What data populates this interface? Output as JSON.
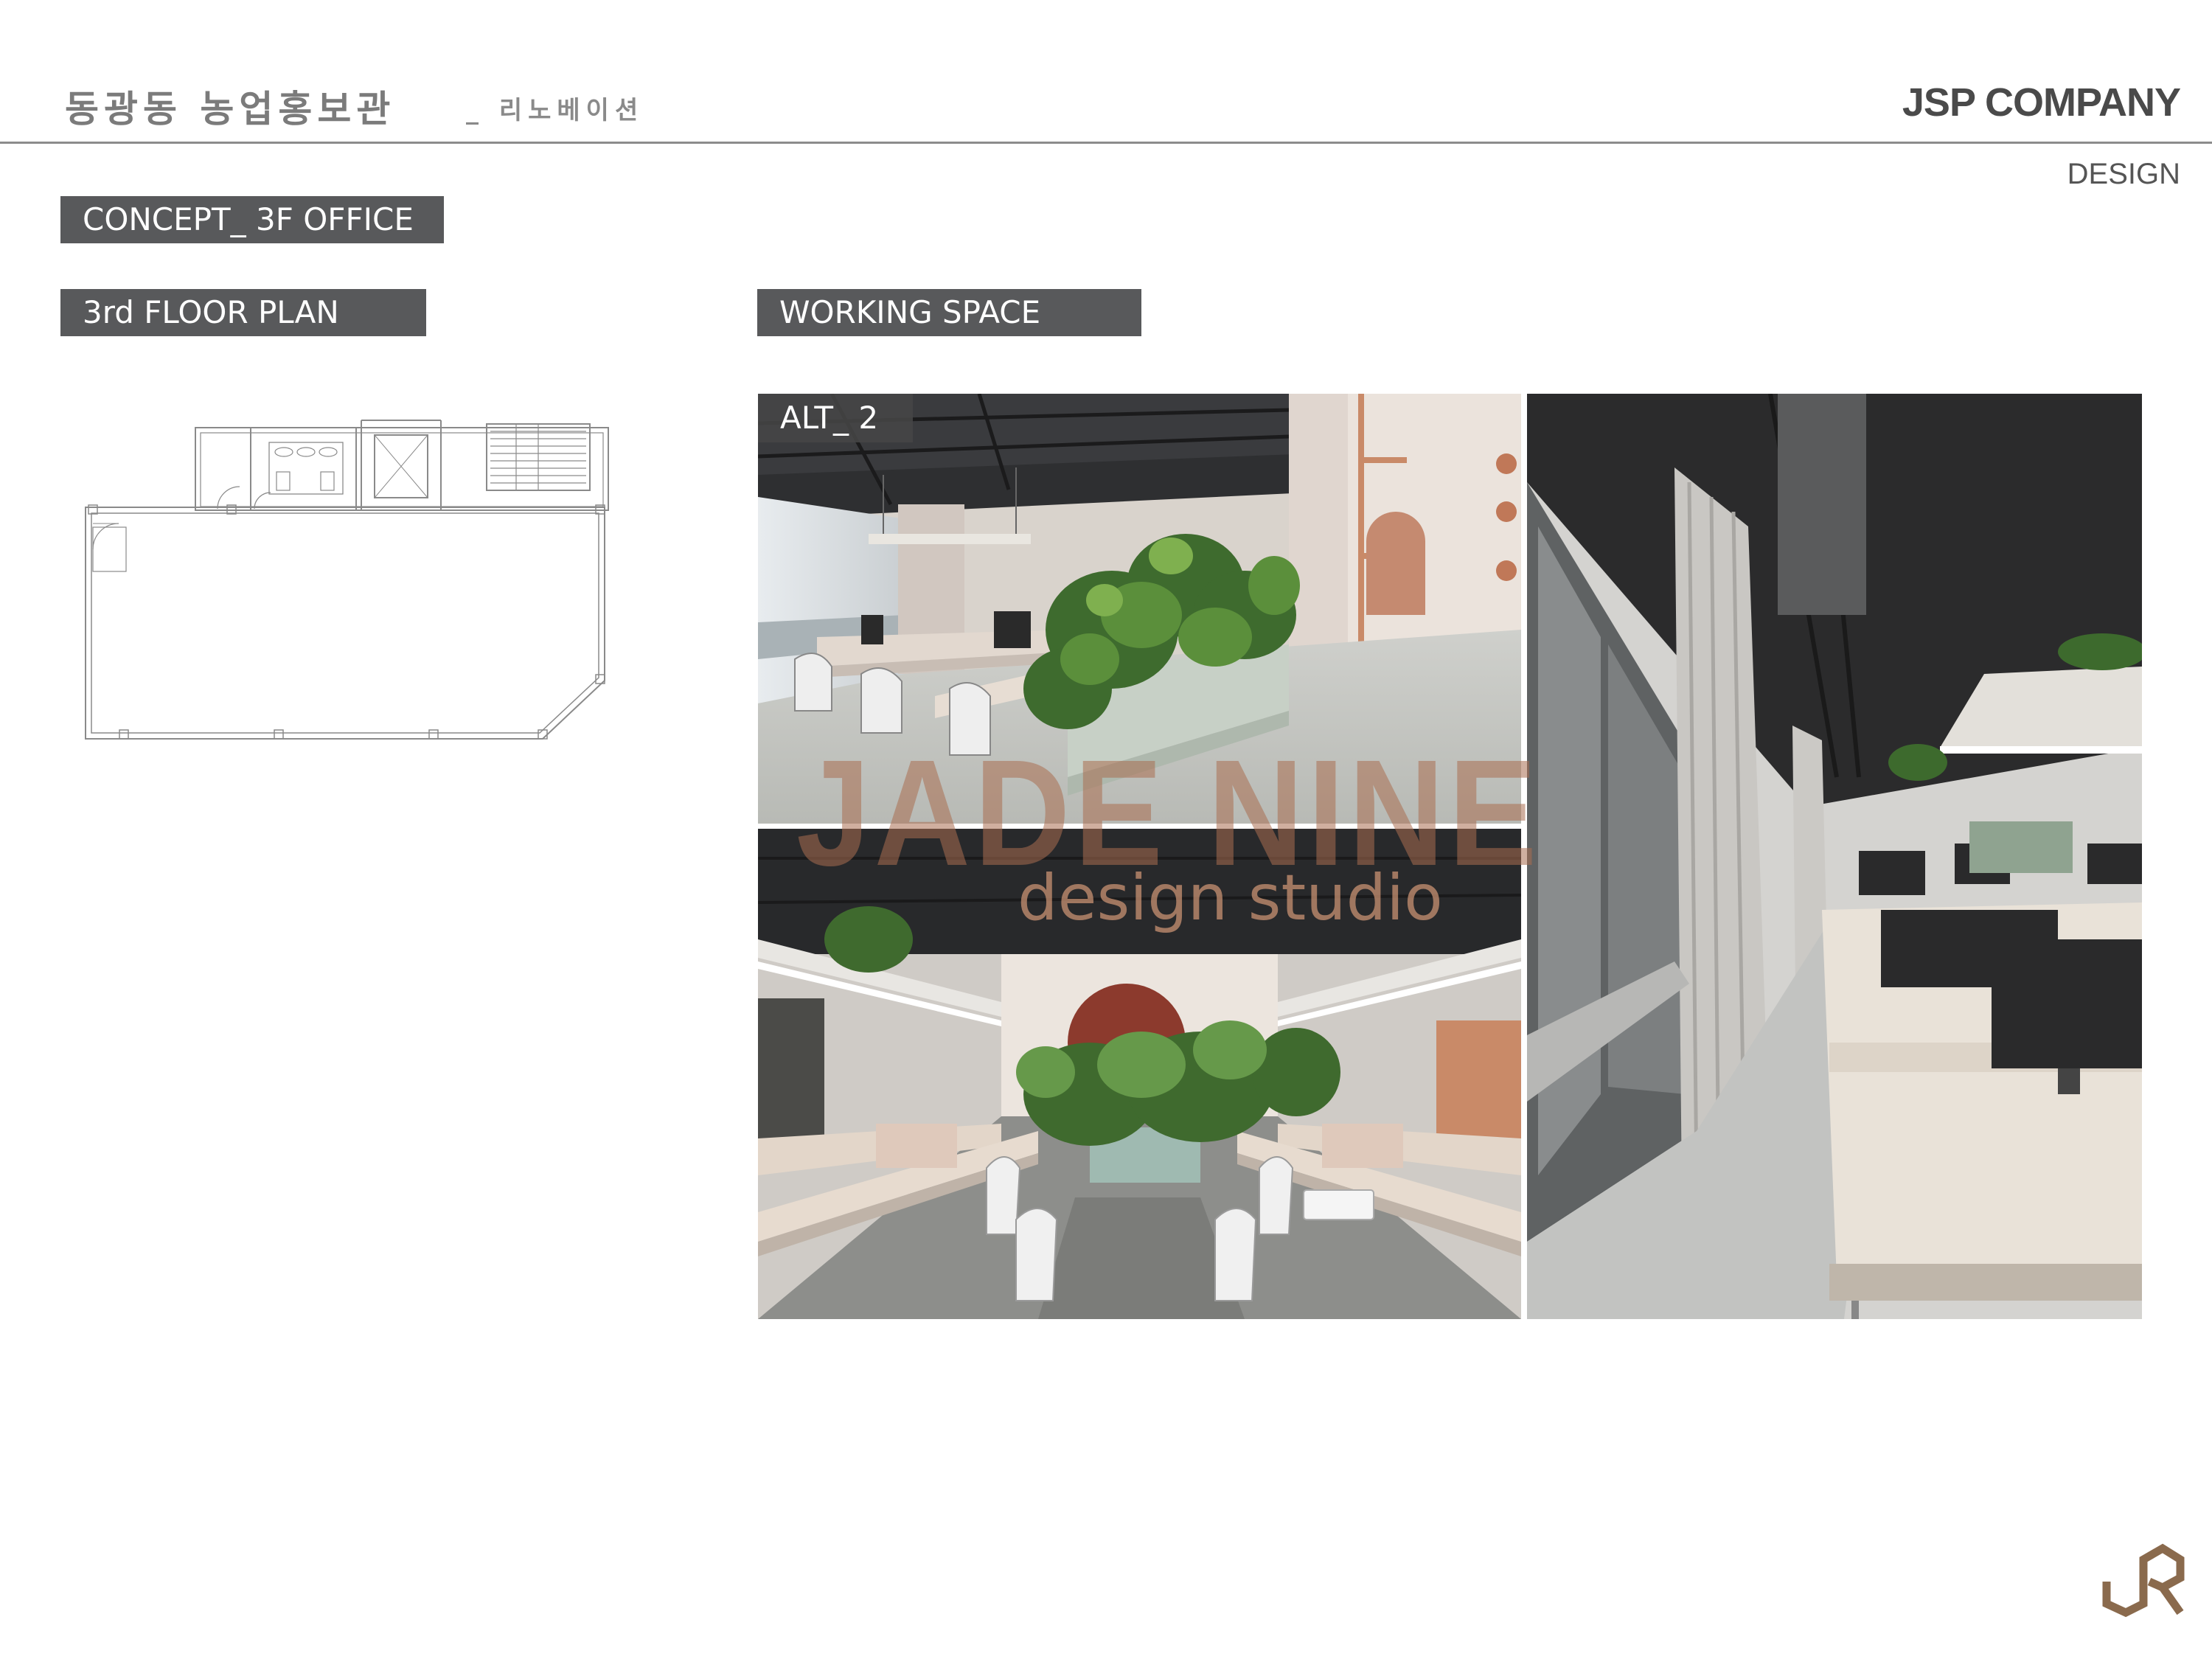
{
  "header": {
    "title": "동광동 농업홍보관",
    "subtitle": "_ 리노베이션",
    "company": "JSP COMPANY",
    "section": "DESIGN"
  },
  "labels": {
    "concept": "CONCEPT_ 3F OFFICE",
    "floor_plan": "3rd FLOOR PLAN",
    "working_space": "WORKING SPACE",
    "alt_tag": "ALT_ 2"
  },
  "watermark": {
    "line1": "JADE NINE",
    "line2": "design studio"
  },
  "colors": {
    "label_bg": "#58595b",
    "header_text": "#7b7b7b",
    "logo_brown": "#8a6a4d",
    "watermark": "#aa6e50"
  },
  "icons": {
    "logo": "jsp-company-logo-icon"
  }
}
